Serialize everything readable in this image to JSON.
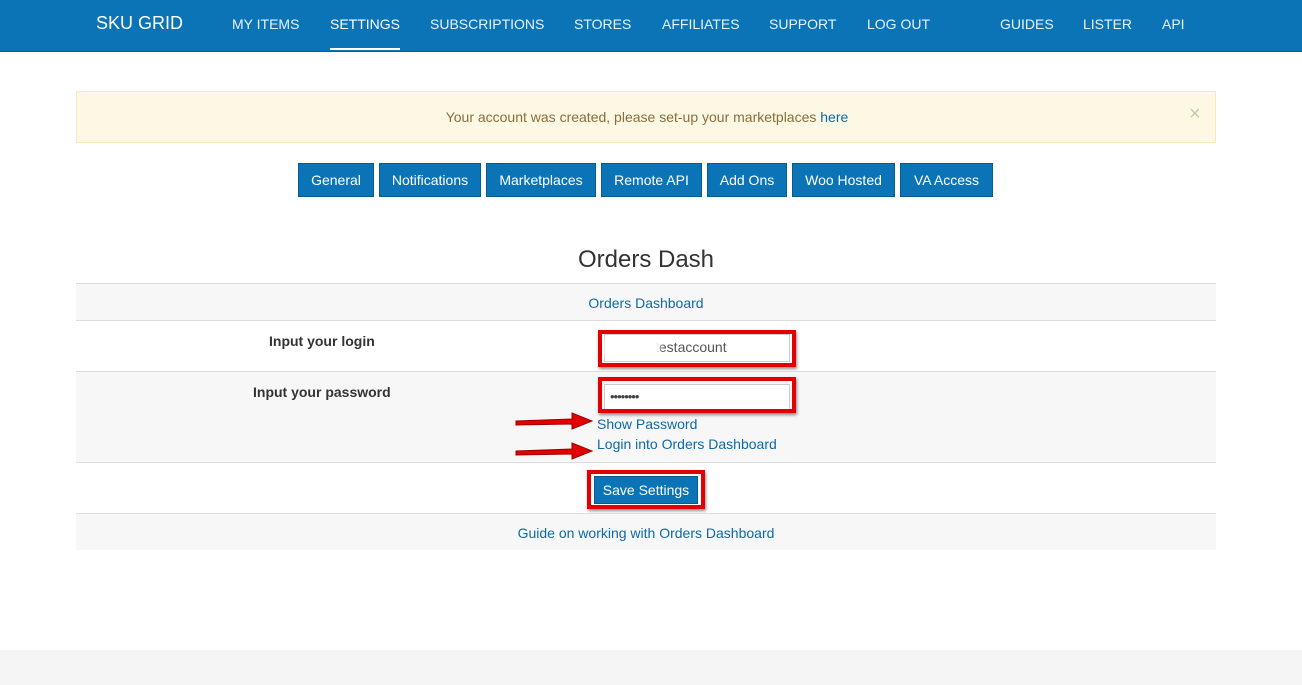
{
  "navbar": {
    "brand": "SKU GRID",
    "items": [
      "MY ITEMS",
      "SETTINGS",
      "SUBSCRIPTIONS",
      "STORES",
      "AFFILIATES",
      "SUPPORT",
      "LOG OUT"
    ],
    "active_item": "SETTINGS",
    "right_items": [
      "GUIDES",
      "LISTER",
      "API"
    ]
  },
  "alert": {
    "message": "Your account was created, please set-up your marketplaces",
    "link": "here",
    "close_symbol": "×"
  },
  "tabs": [
    "General",
    "Notifications",
    "Marketplaces",
    "Remote API",
    "Add Ons",
    "Woo Hosted",
    "VA Access"
  ],
  "section": {
    "title": "Orders Dash",
    "dashboard_link": "Orders Dashboard",
    "login_label": "Input your login",
    "login_value": "testaccount",
    "password_label": "Input your password",
    "password_value": "••••••••",
    "show_password_link": "Show Password",
    "login_dashboard_link": "Login into Orders Dashboard",
    "save_button": "Save Settings",
    "guide_link": "Guide on working with Orders Dashboard"
  },
  "colors": {
    "brand_blue": "#0b74b7",
    "alert_bg": "#fcf8e3",
    "alert_text": "#8a6d3b",
    "link_blue": "#0b6aa8",
    "highlight_red": "#e30000"
  },
  "annotations": {
    "arrow_icon": "red-arrow-right-icon"
  }
}
